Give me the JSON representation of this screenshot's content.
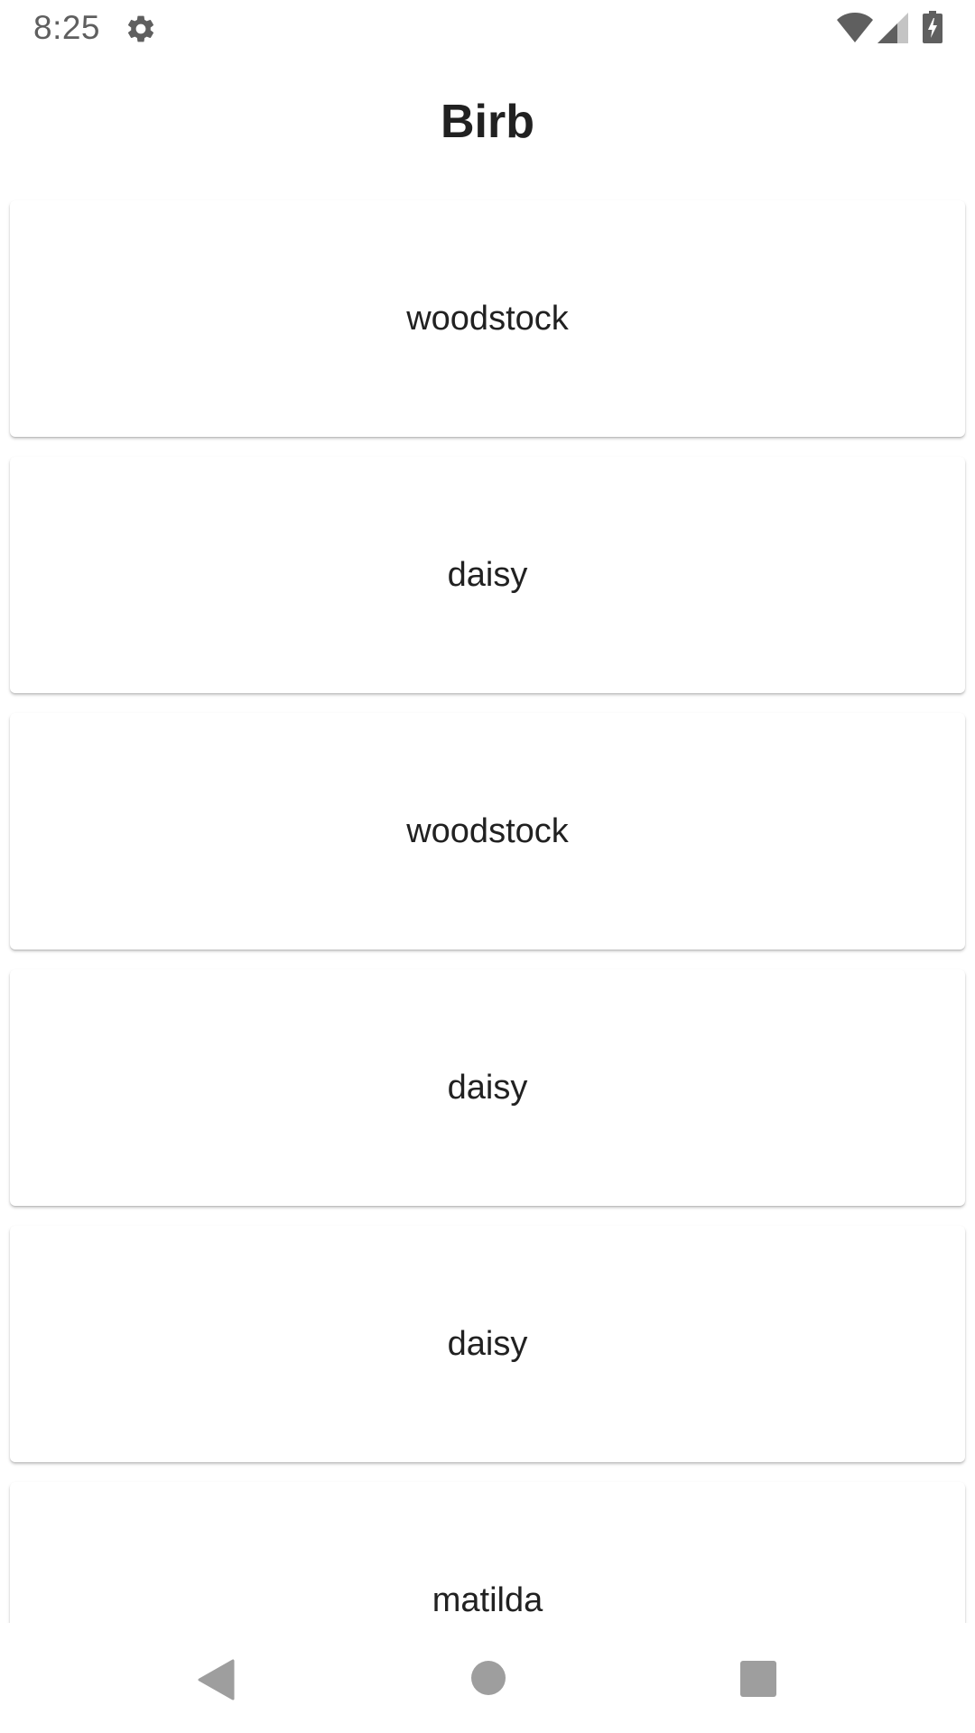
{
  "status_bar": {
    "time": "8:25",
    "icons": [
      "gear-icon",
      "wifi-icon",
      "signal-icon",
      "battery-charging-icon"
    ],
    "icon_color": "#5f5f5f"
  },
  "app": {
    "title": "Birb"
  },
  "list": {
    "items": [
      {
        "label": "woodstock"
      },
      {
        "label": "daisy"
      },
      {
        "label": "woodstock"
      },
      {
        "label": "daisy"
      },
      {
        "label": "daisy"
      },
      {
        "label": "matilda"
      }
    ]
  },
  "nav_bar": {
    "buttons": [
      "back-icon",
      "home-icon",
      "recents-icon"
    ],
    "icon_color": "#9e9e9e"
  }
}
